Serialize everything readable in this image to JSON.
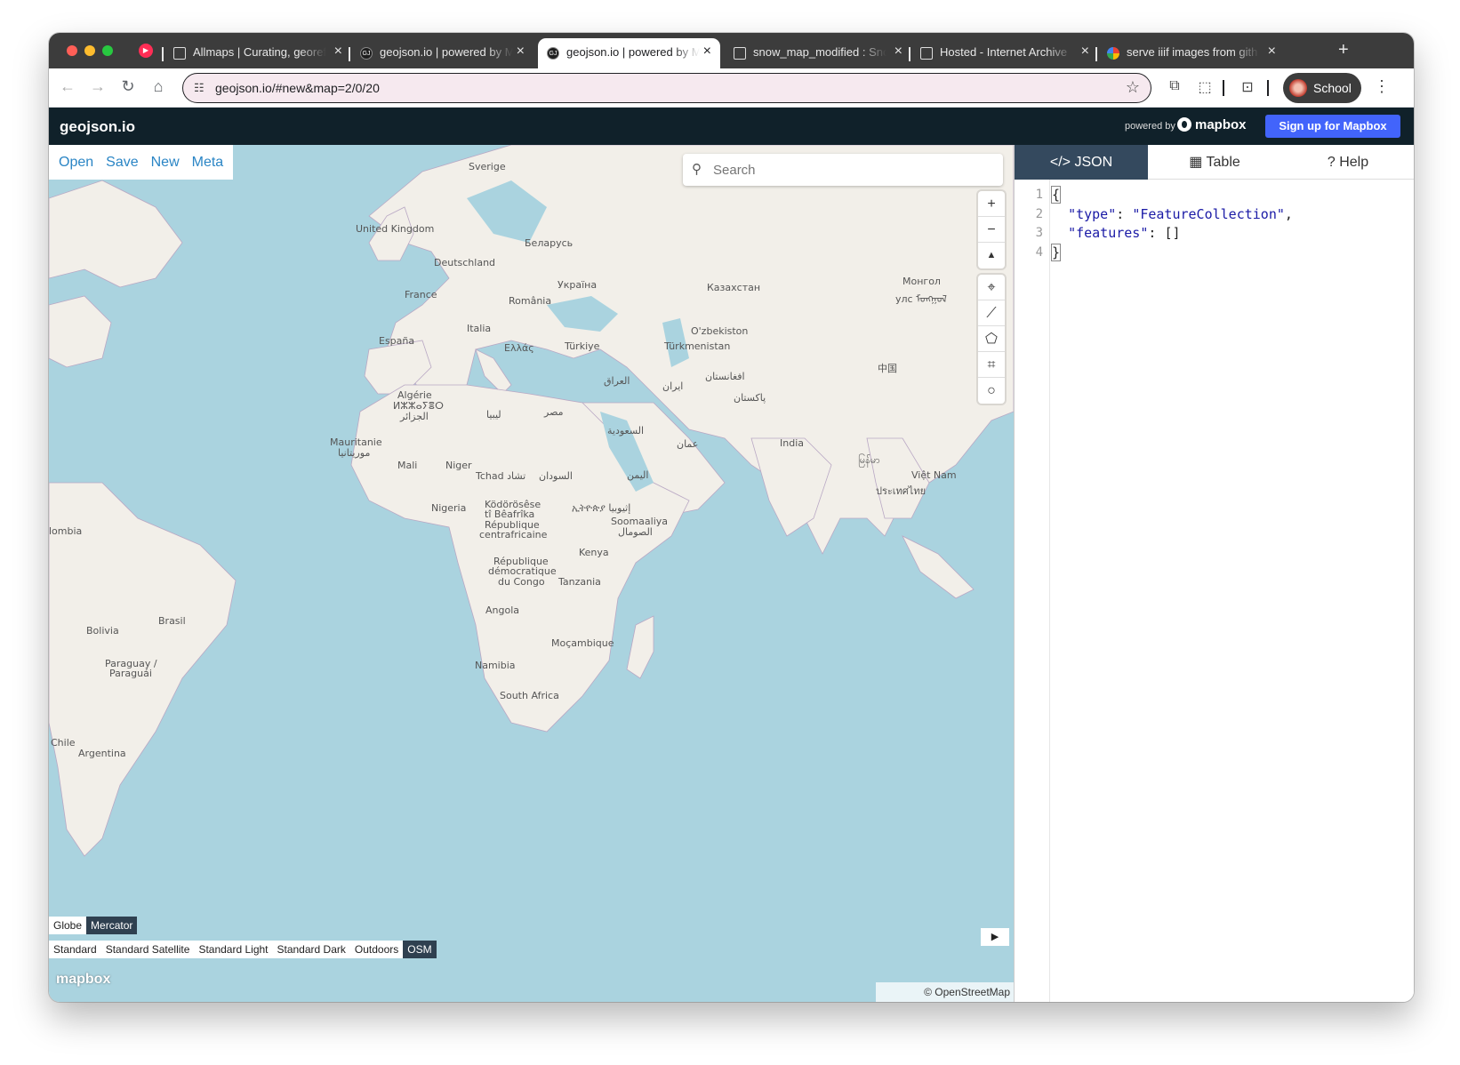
{
  "browser": {
    "tabs": [
      {
        "title": "Allmaps | Curating, georef",
        "icon": "allmaps-icon"
      },
      {
        "title": "geojson.io | powered by M",
        "icon": "geojson-icon"
      },
      {
        "title": "geojson.io | powered by M",
        "icon": "geojson-icon",
        "active": true
      },
      {
        "title": "snow_map_modified : Sno",
        "icon": "archive-icon"
      },
      {
        "title": "Hosted - Internet Archive",
        "icon": "iiif-icon"
      },
      {
        "title": "serve iiif images from gith",
        "icon": "google-icon"
      }
    ],
    "url": "geojson.io/#new&map=2/0/20",
    "profile_label": "School"
  },
  "app": {
    "brand": "geojson.io",
    "powered_by": "powered by",
    "mapbox_label": "mapbox",
    "signup_label": "Sign up for Mapbox"
  },
  "map": {
    "menu": [
      "Open",
      "Save",
      "New",
      "Meta"
    ],
    "search_placeholder": "Search",
    "projections": [
      "Globe",
      "Mercator"
    ],
    "selected_projection": "Mercator",
    "styles": [
      "Standard",
      "Standard Satellite",
      "Standard Light",
      "Standard Dark",
      "Outdoors",
      "OSM"
    ],
    "selected_style": "OSM",
    "attribution": "© OpenStreetMap",
    "watermark": "mapbox",
    "labels": {
      "sverige": "Sverige",
      "uk": "United Kingdom",
      "belarus": "Беларусь",
      "deutschland": "Deutschland",
      "ukraina": "Україна",
      "france": "France",
      "romania": "România",
      "kazakhstan": "Казахстан",
      "mongol": "Монгол",
      "mongol2": "улс ᠮᠣᠩᠭᠣᠯ",
      "espana": "España",
      "italia": "Italia",
      "ellada": "Ελλάς",
      "turkiye": "Türkiye",
      "uzbekiston": "O'zbekiston",
      "turkmenistan": "Türkmenistan",
      "china": "中国",
      "iraq": "العراق",
      "iran": "ایران",
      "afghanistan": "افغانستان",
      "pakistan": "پاکستان",
      "algerie": "Algérie",
      "algerie2": "ⵍⵣⵣⴰⵢⴻⵔ",
      "algerie3": "الجزائر",
      "libya": "ليبيا",
      "egypt": "مصر",
      "saudi": "السعودية",
      "oman": "عمان",
      "india": "India",
      "mauritanie": "Mauritanie",
      "mauritanie2": "موريتانيا",
      "mali": "Mali",
      "niger": "Niger",
      "tchad": "Tchad تشاد",
      "sudan": "السودان",
      "yemen": "اليمن",
      "myanmar": "မြန်မာ",
      "vietnam": "Việt Nam",
      "thailand": "ประเทศไทย",
      "nigeria": "Nigeria",
      "car1": "Ködörösêse",
      "car2": "tî Bêafrîka",
      "car3": "République",
      "car4": "centrafricaine",
      "ethiopia": "ኢትዮጵያ إثيوبيا",
      "somalia": "Soomaaliya",
      "somalia2": "الصومال",
      "kenya": "Kenya",
      "drc1": "République",
      "drc2": "démocratique",
      "drc3": "du Congo",
      "tanzania": "Tanzania",
      "angola": "Angola",
      "mozambique": "Moçambique",
      "namibia": "Namibia",
      "southafrica": "South Africa",
      "colombia": "lombia",
      "brasil": "Brasil",
      "bolivia": "Bolivia",
      "paraguay": "Paraguay /",
      "paraguay2": "Paraguái",
      "chile": "Chile",
      "argentina": "Argentina"
    }
  },
  "panel": {
    "tabs": [
      "JSON",
      "Table",
      "Help"
    ],
    "active_tab": "JSON",
    "line_numbers": [
      "1",
      "2",
      "3",
      "4"
    ],
    "code": {
      "open": "{",
      "key_type": "\"type\"",
      "val_type": "\"FeatureCollection\"",
      "key_features": "\"features\"",
      "val_features": "[]",
      "close": "}"
    }
  }
}
